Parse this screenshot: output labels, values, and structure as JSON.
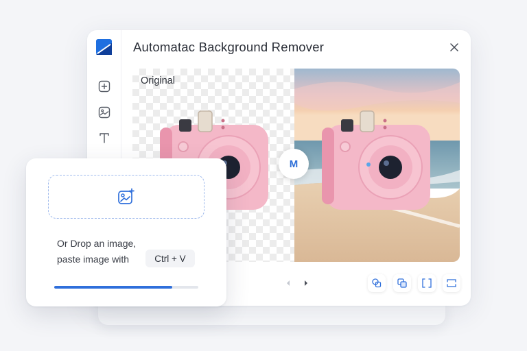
{
  "window": {
    "title": "Automatac Background Remover"
  },
  "sidebar": {
    "items": [
      {
        "icon": "add-square-icon"
      },
      {
        "icon": "image-icon"
      },
      {
        "icon": "text-icon"
      }
    ]
  },
  "preview": {
    "original_label": "Original",
    "divider_glyph": "M"
  },
  "toolbar": {
    "tools": [
      {
        "icon": "layers-overlap-icon"
      },
      {
        "icon": "duplicate-icon"
      },
      {
        "icon": "crop-frame-icon"
      },
      {
        "icon": "resize-frame-icon"
      }
    ]
  },
  "upload": {
    "hint_line1": "Or Drop an image,",
    "hint_line2": "paste image with",
    "shortcut": "Ctrl + V",
    "progress": 0.82
  },
  "colors": {
    "accent": "#2f6fdb",
    "camera_pink": "#f4b8c8",
    "dropzone_border": "#9db8ec"
  }
}
